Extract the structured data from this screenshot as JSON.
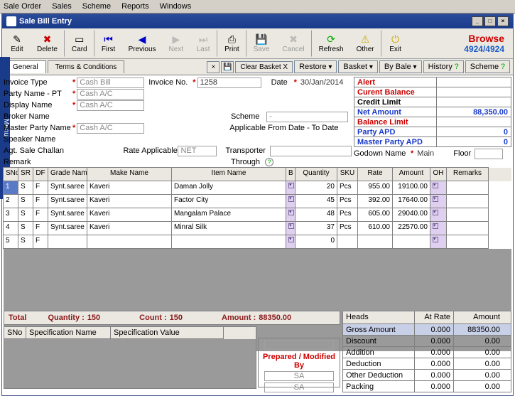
{
  "menubar": [
    "Sale Order",
    "Sales",
    "Scheme",
    "Reports",
    "Windows"
  ],
  "window_title": "Sale Bill Entry",
  "toolbar": {
    "edit": "Edit",
    "delete": "Delete",
    "card": "Card",
    "first": "First",
    "previous": "Previous",
    "next": "Next",
    "last": "Last",
    "print": "Print",
    "save": "Save",
    "cancel": "Cancel",
    "refresh": "Refresh",
    "other": "Other",
    "exit": "Exit"
  },
  "browse": {
    "label": "Browse",
    "count": "4924/4924"
  },
  "tabs": {
    "general": "General",
    "terms": "Terms & Conditions"
  },
  "tabrow_buttons": {
    "clear_basket": "Clear Basket X",
    "restore": "Restore",
    "basket": "Basket",
    "by_bale": "By Bale",
    "history": "History",
    "scheme": "Scheme"
  },
  "form": {
    "invoice_type": {
      "label": "Invoice Type",
      "value": "Cash Bill"
    },
    "invoice_no": {
      "label": "Invoice No.",
      "value": "1258"
    },
    "date": {
      "label": "Date",
      "value": "30/Jan/2014"
    },
    "party_name": {
      "label": "Party Name - PT",
      "value": "Cash A/C"
    },
    "display_name": {
      "label": "Display Name",
      "value": "Cash A/C"
    },
    "broker_name": {
      "label": "Broker Name",
      "value": ""
    },
    "scheme": {
      "label": "Scheme",
      "value": "-"
    },
    "master_party": {
      "label": "Master Party Name",
      "value": "Cash A/C"
    },
    "applicable": {
      "label": "Applicable From Date - To Date"
    },
    "speaker_name": {
      "label": "Speaker Name",
      "value": ""
    },
    "agt_challan": {
      "label": "Agt. Sale Challan",
      "value": ""
    },
    "rate_app": {
      "label": "Rate Applicable",
      "value": "NET"
    },
    "transporter": {
      "label": "Transporter",
      "value": ""
    },
    "remark": {
      "label": "Remark",
      "value": ""
    },
    "through": {
      "label": "Through",
      "value": ""
    },
    "godown": {
      "label": "Godown Name",
      "value": "Main"
    },
    "floor": {
      "label": "Floor",
      "value": ""
    }
  },
  "sidebar": {
    "alert": "Alert",
    "curent_balance": "Curent Balance",
    "credit_limit": "Credit Limit",
    "net_amount": {
      "label": "Net Amount",
      "value": "88,350.00"
    },
    "balance_limit": "Balance Limit",
    "party_apd": {
      "label": "Party APD",
      "value": "0"
    },
    "master_party_apd": {
      "label": "Master Party APD",
      "value": "0"
    }
  },
  "grid": {
    "headers": [
      "SNo",
      "SR",
      "DF",
      "Grade Name",
      "Make Name",
      "Item Name",
      "B",
      "Quantity",
      "SKU",
      "Rate",
      "Amount",
      "OH",
      "Remarks"
    ],
    "rows": [
      {
        "sno": "1",
        "sr": "S",
        "df": "F",
        "gn": "Synt.saree",
        "mn": "Kaveri",
        "in": "Daman Jolly",
        "qty": "20",
        "sku": "Pcs",
        "rate": "955.00",
        "amt": "19100.00"
      },
      {
        "sno": "2",
        "sr": "S",
        "df": "F",
        "gn": "Synt.saree",
        "mn": "Kaveri",
        "in": "Factor City",
        "qty": "45",
        "sku": "Pcs",
        "rate": "392.00",
        "amt": "17640.00"
      },
      {
        "sno": "3",
        "sr": "S",
        "df": "F",
        "gn": "Synt.saree",
        "mn": "Kaveri",
        "in": "Mangalam Palace",
        "qty": "48",
        "sku": "Pcs",
        "rate": "605.00",
        "amt": "29040.00"
      },
      {
        "sno": "4",
        "sr": "S",
        "df": "F",
        "gn": "Synt.saree",
        "mn": "Kaveri",
        "in": "Minral Silk",
        "qty": "37",
        "sku": "Pcs",
        "rate": "610.00",
        "amt": "22570.00"
      },
      {
        "sno": "5",
        "sr": "S",
        "df": "F",
        "gn": "",
        "mn": "",
        "in": "",
        "qty": "0",
        "sku": "",
        "rate": "",
        "amt": ""
      }
    ]
  },
  "totals": {
    "total_label": "Total",
    "qty_label": "Quantity :",
    "qty": "150",
    "count_label": "Count :",
    "count": "150",
    "amount_label": "Amount :",
    "amount": "88350.00"
  },
  "spec": {
    "headers": [
      "SNo",
      "Specification Name",
      "Specification Value"
    ]
  },
  "prepared": {
    "label": "Prepared / Modified By",
    "v1": "SA",
    "v2": "SA"
  },
  "heads": {
    "headers": [
      "Heads",
      "At Rate",
      "Amount"
    ],
    "rows": [
      {
        "h": "Gross Amount",
        "r": "0.000",
        "a": "88350.00"
      },
      {
        "h": "Discount",
        "r": "0.000",
        "a": "0.00"
      },
      {
        "h": "Addition",
        "r": "0.000",
        "a": "0.00"
      },
      {
        "h": "Deduction",
        "r": "0.000",
        "a": "0.00"
      },
      {
        "h": "Other Deduction",
        "r": "0.000",
        "a": "0.00"
      },
      {
        "h": "Packing",
        "r": "0.000",
        "a": "0.00"
      }
    ]
  },
  "gutter": "Menu"
}
